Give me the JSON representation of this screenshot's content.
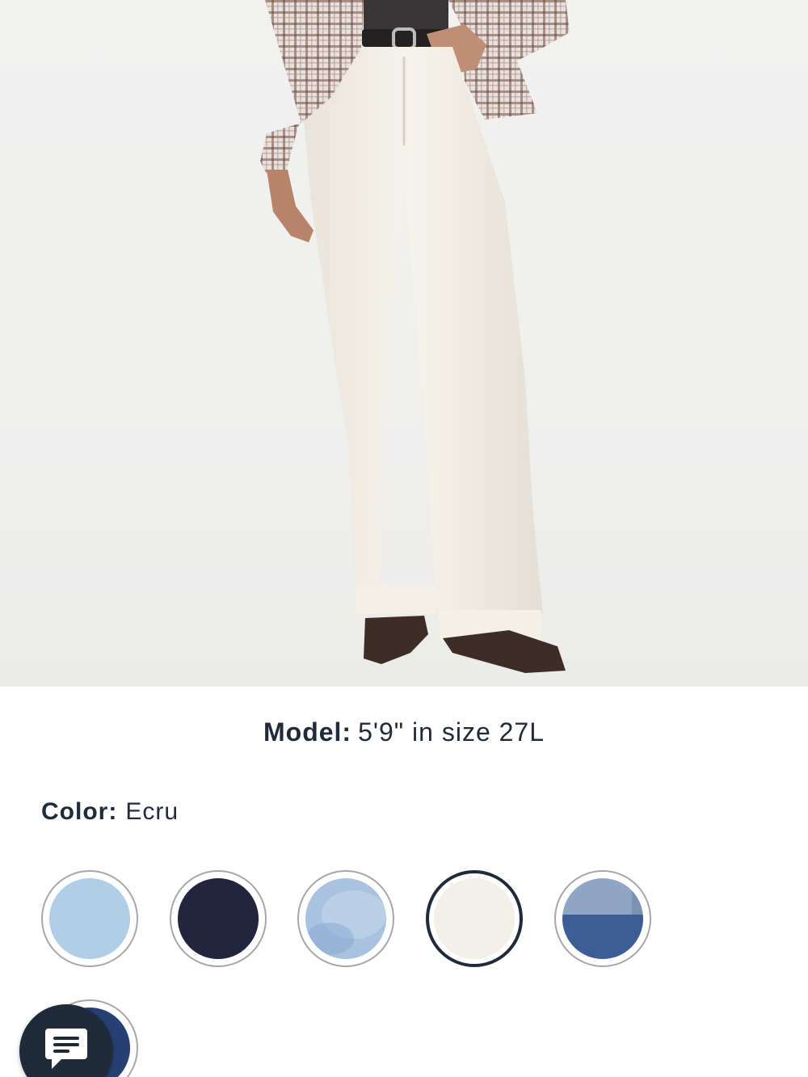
{
  "product_image": {
    "alt_icon": "product-photo"
  },
  "model_info": {
    "label": "Model:",
    "value": "5'9\" in size 27L"
  },
  "color": {
    "label": "Color:",
    "selected_value": "Ecru"
  },
  "swatches": [
    {
      "icon": "light-wash-denim-swatch",
      "selected": false,
      "tone": "#bcd6ec"
    },
    {
      "icon": "dark-rinse-denim-swatch",
      "selected": false,
      "tone": "#1b1f33"
    },
    {
      "icon": "medium-light-wash-denim-swatch",
      "selected": false,
      "tone": "#a8c2df"
    },
    {
      "icon": "ecru-denim-swatch",
      "selected": true,
      "tone": "#eeebe4"
    },
    {
      "icon": "two-tone-denim-swatch",
      "selected": false,
      "tone": "#4a6aa0"
    },
    {
      "icon": "dark-indigo-denim-swatch",
      "selected": false,
      "tone": "#223a6a"
    }
  ],
  "chat": {
    "icon": "chat-bubble-icon"
  },
  "colors": {
    "text": "#1f2b3a",
    "swatch_border": "#a7a7a7",
    "selected_border": "#1f2b3a",
    "chat_bg": "#1f2b3a"
  }
}
